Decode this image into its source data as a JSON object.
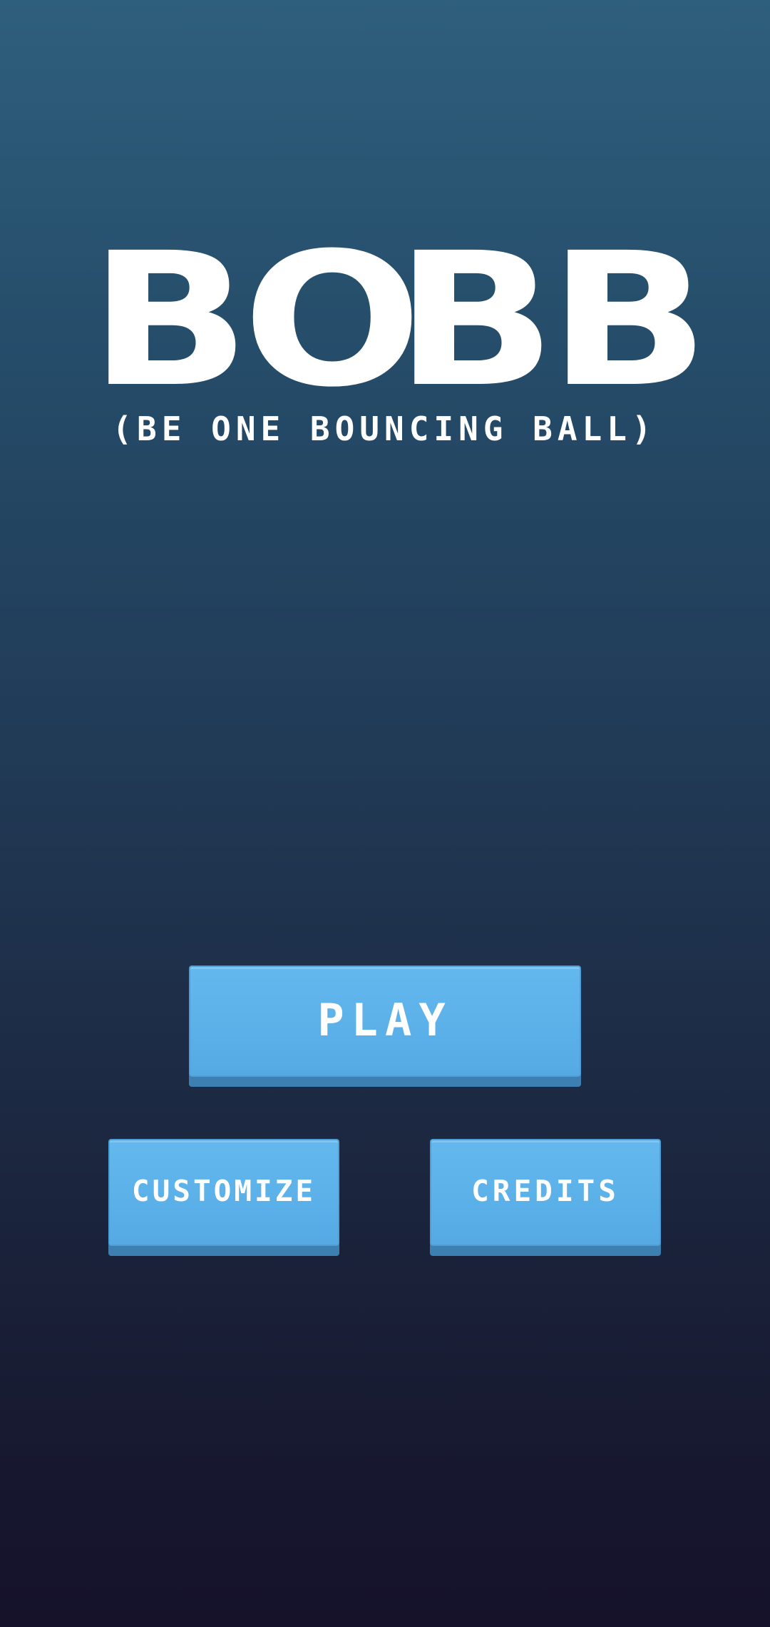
{
  "title": {
    "letters": [
      "B",
      "O",
      "B",
      "B"
    ],
    "subtitle": "(BE ONE BOUNCING BALL)"
  },
  "menu": {
    "play_label": "PLAY",
    "customize_label": "CUSTOMIZE",
    "credits_label": "CREDITS"
  },
  "colors": {
    "button": "#5ab2ea",
    "button_shadow": "#3d7fb1",
    "background_top": "#2e5f7d",
    "background_bottom": "#15112a",
    "text": "#ffffff"
  }
}
